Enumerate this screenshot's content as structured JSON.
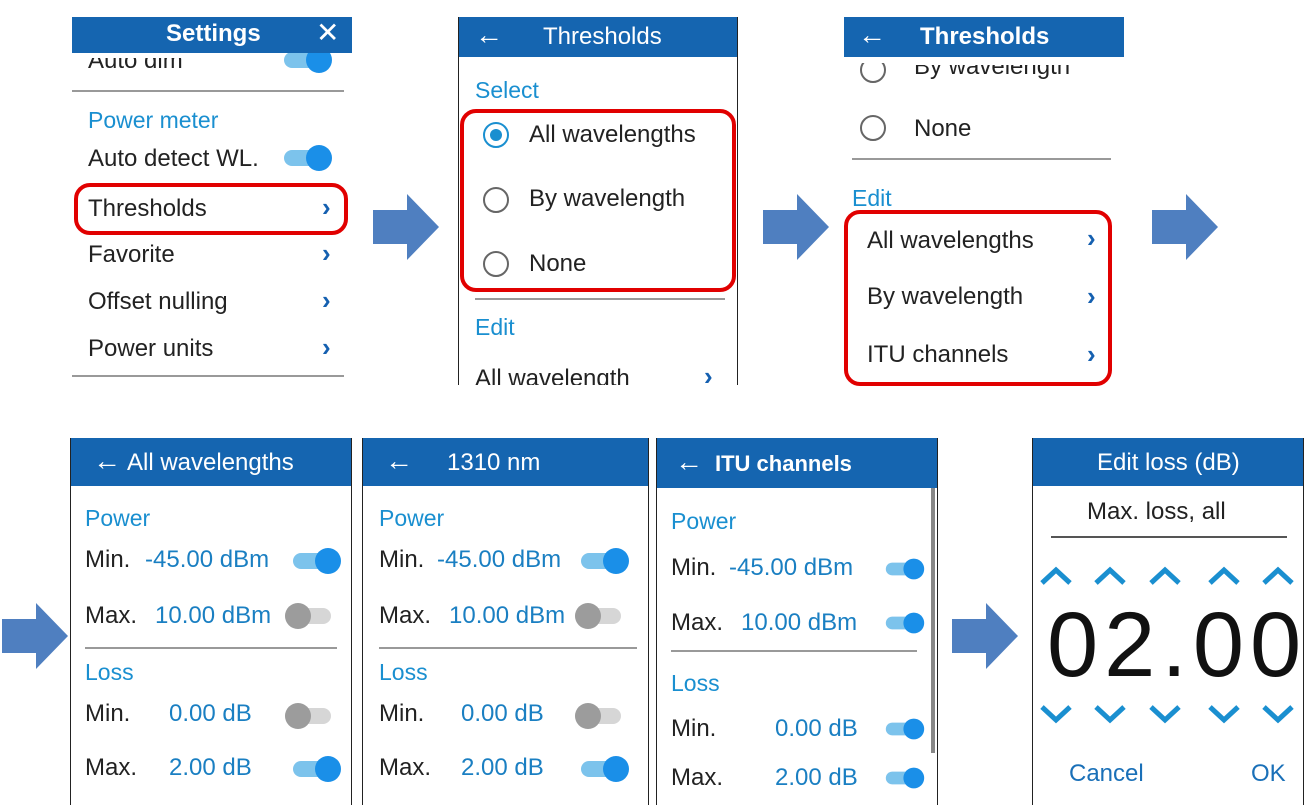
{
  "settings": {
    "title": "Settings",
    "partial_item": "Auto dim",
    "section": "Power meter",
    "auto_detect": "Auto detect WL.",
    "items": [
      "Thresholds",
      "Favorite",
      "Offset nulling",
      "Power units"
    ]
  },
  "thresholds1": {
    "title": "Thresholds",
    "select_label": "Select",
    "options": [
      "All wavelengths",
      "By wavelength",
      "None"
    ],
    "edit_label": "Edit",
    "partial_item": "All wavelength"
  },
  "thresholds2": {
    "title": "Thresholds",
    "partial_option": "By wavelength",
    "none_option": "None",
    "edit_label": "Edit",
    "edit_items": [
      "All wavelengths",
      "By wavelength",
      "ITU channels"
    ]
  },
  "threshold_screens": [
    {
      "title": "All wavelengths",
      "power_label": "Power",
      "loss_label": "Loss",
      "min_label": "Min.",
      "max_label": "Max.",
      "power_min": "-45.00 dBm",
      "power_max": "10.00 dBm",
      "loss_min": "0.00 dB",
      "loss_max": "2.00 dB"
    },
    {
      "title": "1310 nm",
      "power_label": "Power",
      "loss_label": "Loss",
      "min_label": "Min.",
      "max_label": "Max.",
      "power_min": "-45.00 dBm",
      "power_max": "10.00 dBm",
      "loss_min": "0.00 dB",
      "loss_max": "2.00 dB"
    },
    {
      "title": "ITU channels",
      "power_label": "Power",
      "loss_label": "Loss",
      "min_label": "Min.",
      "max_label": "Max.",
      "power_min": "-45.00 dBm",
      "power_max": "10.00 dBm",
      "loss_min": "0.00 dB",
      "loss_max": "2.00 dB"
    }
  ],
  "edit_loss": {
    "title": "Edit loss (dB)",
    "subtitle": "Max. loss, all",
    "value": "02.00",
    "cancel": "Cancel",
    "ok": "OK"
  },
  "colors": {
    "header": "#1565b0",
    "accent": "#1a8fd0",
    "highlight": "#e10000",
    "arrow": "#4f7fc0"
  }
}
